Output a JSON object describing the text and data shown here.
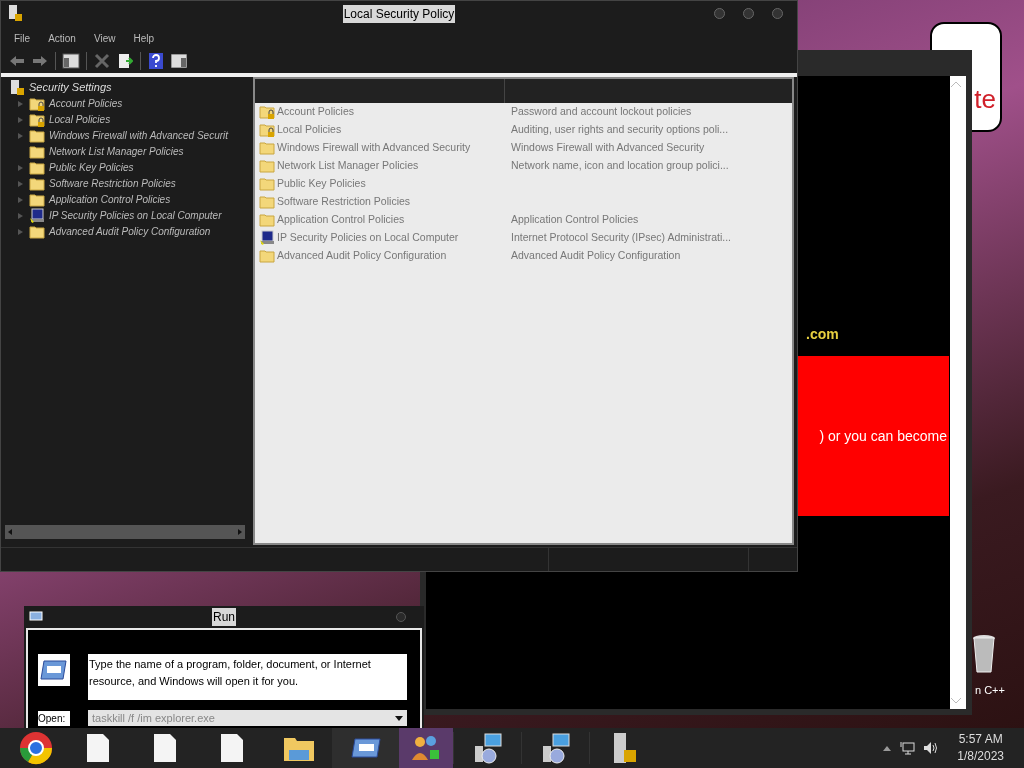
{
  "window": {
    "title": "Local Security Policy",
    "menu": [
      "File",
      "Action",
      "View",
      "Help"
    ],
    "tree": {
      "label": "Security Settings",
      "children": [
        {
          "label": "Account Policies",
          "kind": "lock-folder",
          "expandable": true
        },
        {
          "label": "Local Policies",
          "kind": "lock-folder",
          "expandable": true
        },
        {
          "label": "Windows Firewall with Advanced Securit",
          "kind": "folder",
          "expandable": true
        },
        {
          "label": "Network List Manager Policies",
          "kind": "folder",
          "expandable": false
        },
        {
          "label": "Public Key Policies",
          "kind": "folder",
          "expandable": true
        },
        {
          "label": "Software Restriction Policies",
          "kind": "folder",
          "expandable": true
        },
        {
          "label": "Application Control Policies",
          "kind": "folder",
          "expandable": true
        },
        {
          "label": "IP Security Policies on Local Computer",
          "kind": "computer",
          "expandable": true
        },
        {
          "label": "Advanced Audit Policy Configuration",
          "kind": "folder",
          "expandable": true
        }
      ]
    },
    "list": {
      "rows": [
        {
          "name": "Account Policies",
          "description": "Password and account lockout policies",
          "kind": "lock-folder"
        },
        {
          "name": "Local Policies",
          "description": "Auditing, user rights and security options poli...",
          "kind": "lock-folder"
        },
        {
          "name": "Windows Firewall with Advanced Security",
          "description": "Windows Firewall with Advanced Security",
          "kind": "folder"
        },
        {
          "name": "Network List Manager Policies",
          "description": "Network name, icon and location group polici...",
          "kind": "folder"
        },
        {
          "name": "Public Key Policies",
          "kind": "folder"
        },
        {
          "name": "Software Restriction Policies",
          "kind": "folder"
        },
        {
          "name": "Application Control Policies",
          "description": "Application Control Policies",
          "kind": "folder"
        },
        {
          "name": "IP Security Policies on Local Computer",
          "description": "Internet Protocol Security (IPsec) Administrati...",
          "kind": "computer"
        },
        {
          "name": "Advanced Audit Policy Configuration",
          "description": "Advanced Audit Policy Configuration",
          "kind": "folder"
        }
      ]
    }
  },
  "background_window": {
    "link_text": ".com",
    "banner_text": ") or you can become"
  },
  "desktop": {
    "bubble_text": "te",
    "icon_label": "n C++"
  },
  "run_dialog": {
    "title": "Run",
    "prompt": "Type the name of a program, folder, document, or Internet resource, and Windows will open it for you.",
    "open_label": "Open:",
    "value": "taskkill /f /im explorer.exe"
  },
  "taskbar": {
    "time": "5:57 AM",
    "date": "1/8/2023"
  }
}
